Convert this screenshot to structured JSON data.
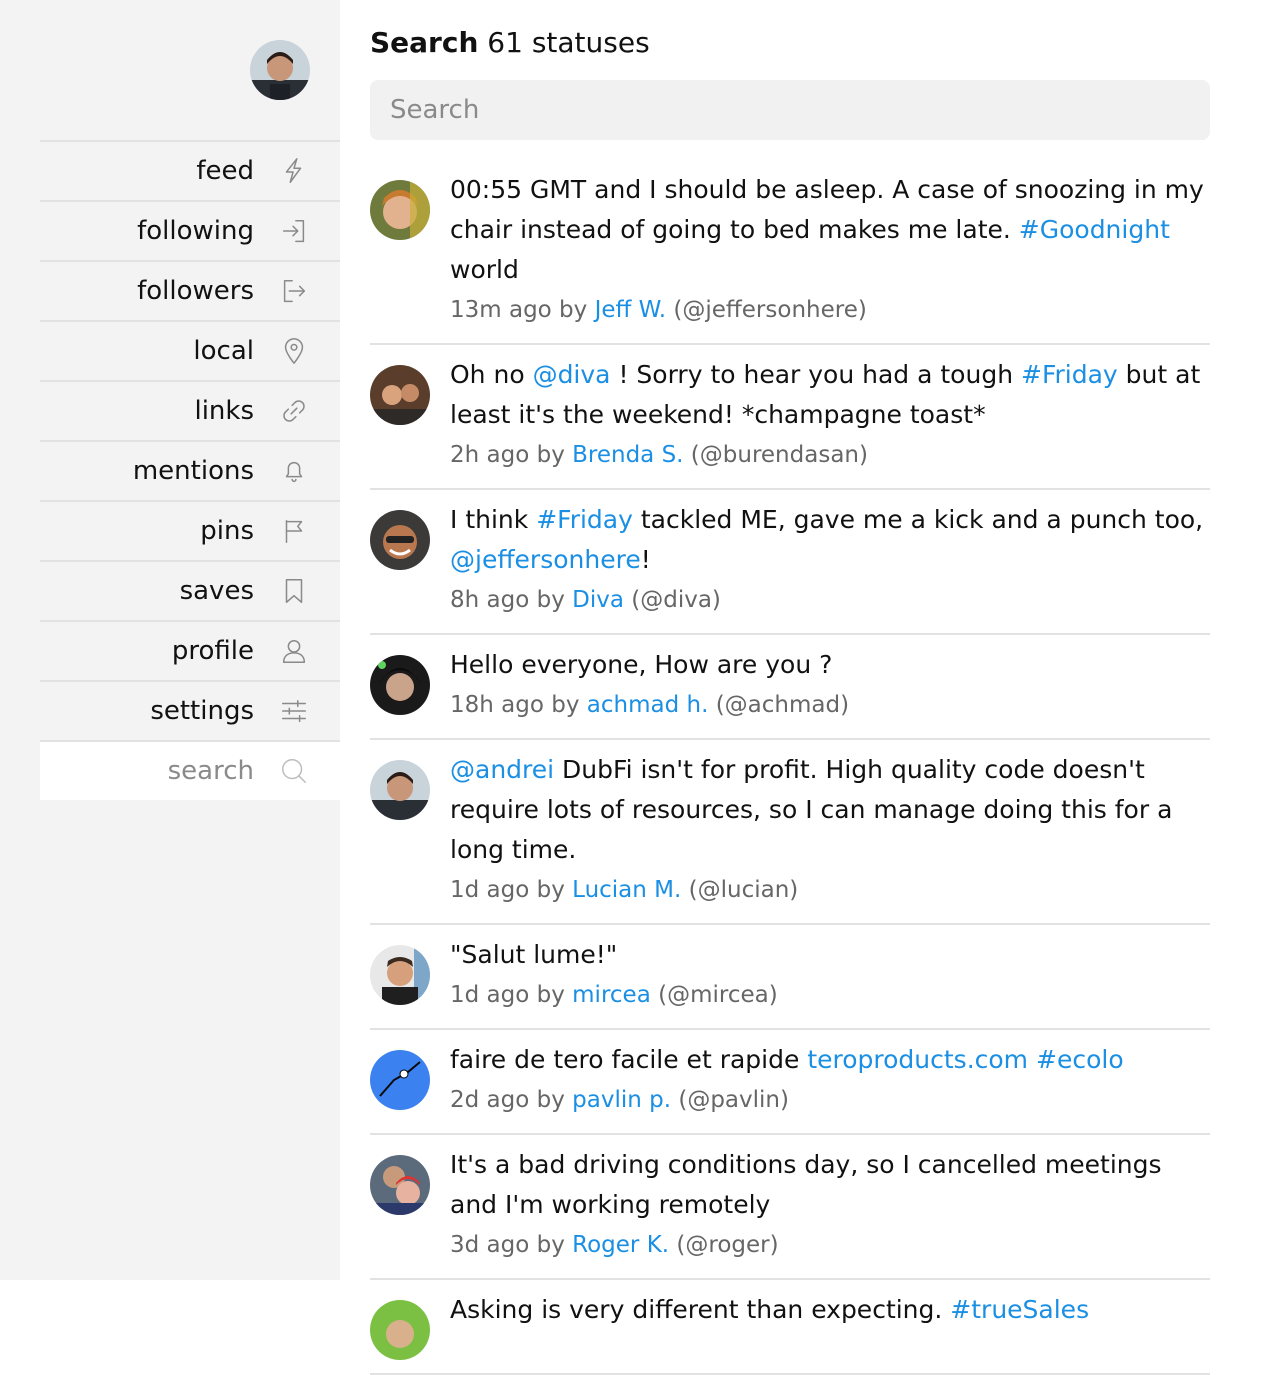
{
  "sidebar": {
    "items": [
      {
        "label": "feed",
        "icon": "lightning-icon"
      },
      {
        "label": "following",
        "icon": "sign-in-icon"
      },
      {
        "label": "followers",
        "icon": "sign-out-icon"
      },
      {
        "label": "local",
        "icon": "map-pin-icon"
      },
      {
        "label": "links",
        "icon": "link-icon"
      },
      {
        "label": "mentions",
        "icon": "bell-icon"
      },
      {
        "label": "pins",
        "icon": "flag-icon"
      },
      {
        "label": "saves",
        "icon": "bookmark-icon"
      },
      {
        "label": "profile",
        "icon": "user-icon"
      },
      {
        "label": "settings",
        "icon": "sliders-icon"
      },
      {
        "label": "search",
        "icon": "search-icon",
        "active": true
      }
    ]
  },
  "header": {
    "title_bold": "Search",
    "title_rest": " 61 statuses"
  },
  "search": {
    "placeholder": "Search"
  },
  "colors": {
    "link": "#1a8fe3",
    "sidebar_bg": "#f3f3f3",
    "divider": "#e2e2e2"
  },
  "statuses": [
    {
      "segments": [
        {
          "t": "00:55 GMT and I should be asleep. A case of snoozing in my chair instead of going to bed makes me late. "
        },
        {
          "t": "#Goodnight",
          "link": true
        },
        {
          "t": " world"
        }
      ],
      "time": "13m ago by ",
      "name": "Jeff W.",
      "handle": " (@jeffersonhere)"
    },
    {
      "segments": [
        {
          "t": "Oh no "
        },
        {
          "t": "@diva",
          "link": true
        },
        {
          "t": " ! Sorry to hear you had a tough "
        },
        {
          "t": "#Friday",
          "link": true
        },
        {
          "t": " but at least it's the weekend! *champagne toast*"
        }
      ],
      "time": "2h ago by ",
      "name": "Brenda S.",
      "handle": " (@burendasan)"
    },
    {
      "segments": [
        {
          "t": "I think "
        },
        {
          "t": "#Friday",
          "link": true
        },
        {
          "t": " tackled ME, gave me a kick and a punch too, "
        },
        {
          "t": "@jeffersonhere",
          "link": true
        },
        {
          "t": "!"
        }
      ],
      "time": "8h ago by ",
      "name": "Diva",
      "handle": " (@diva)"
    },
    {
      "segments": [
        {
          "t": "Hello everyone, How are you ?"
        }
      ],
      "time": "18h ago by ",
      "name": "achmad h.",
      "handle": " (@achmad)"
    },
    {
      "segments": [
        {
          "t": "@andrei",
          "link": true
        },
        {
          "t": " DubFi isn't for profit. High quality code doesn't require lots of resources, so I can manage doing this for a long time."
        }
      ],
      "time": "1d ago by ",
      "name": "Lucian M.",
      "handle": " (@lucian)"
    },
    {
      "segments": [
        {
          "t": "\"Salut lume!\""
        }
      ],
      "time": "1d ago by ",
      "name": "mircea",
      "handle": " (@mircea)"
    },
    {
      "segments": [
        {
          "t": "faire de tero facile et rapide "
        },
        {
          "t": "teroproducts.com",
          "link": true
        },
        {
          "t": " "
        },
        {
          "t": "#ecolo",
          "link": true
        }
      ],
      "time": "2d ago by ",
      "name": "pavlin p.",
      "handle": " (@pavlin)"
    },
    {
      "segments": [
        {
          "t": "It's a bad driving conditions day, so I cancelled meetings and I'm working remotely"
        }
      ],
      "time": "3d ago by ",
      "name": "Roger K.",
      "handle": " (@roger)"
    },
    {
      "segments": [
        {
          "t": "Asking is very different than expecting. "
        },
        {
          "t": "#trueSales",
          "link": true
        }
      ],
      "time": "",
      "name": "",
      "handle": ""
    }
  ]
}
